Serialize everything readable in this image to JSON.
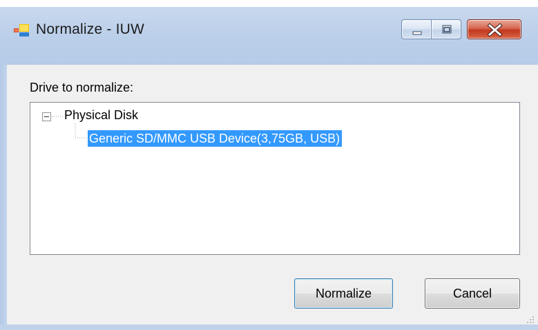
{
  "window": {
    "title": "Normalize - IUW",
    "icon": "app-window-icon",
    "controls": {
      "minimize": "minimize-icon",
      "maximize": "maximize-icon",
      "close": "close-icon"
    }
  },
  "form": {
    "label": "Drive to normalize:",
    "tree": {
      "root": {
        "label": "Physical Disk",
        "expanded": true,
        "children": [
          {
            "label": "Generic SD/MMC USB Device(3,75GB, USB)",
            "selected": true
          }
        ]
      }
    }
  },
  "buttons": {
    "normalize": "Normalize",
    "cancel": "Cancel"
  },
  "colors": {
    "selection": "#3399ff",
    "client_background": "#f0f0f0",
    "close_button": "#c2371d"
  }
}
